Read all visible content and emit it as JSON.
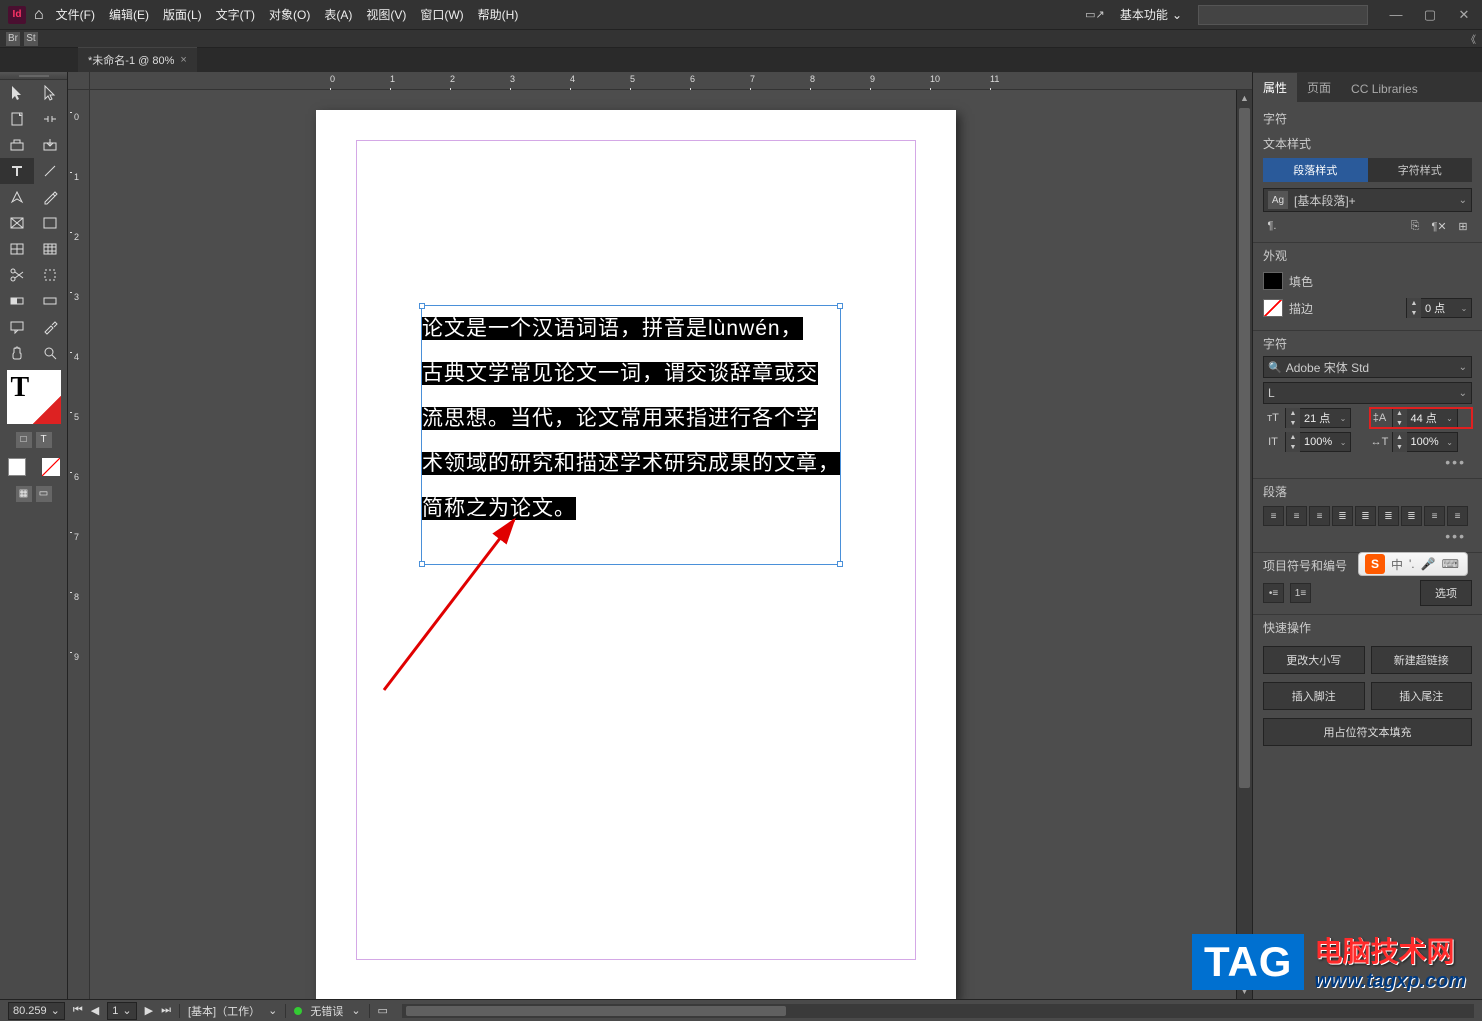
{
  "title_bar": {
    "app_abbrev": "Id",
    "menus": [
      "文件(F)",
      "编辑(E)",
      "版面(L)",
      "文字(T)",
      "对象(O)",
      "表(A)",
      "视图(V)",
      "窗口(W)",
      "帮助(H)"
    ],
    "workspace": "基本功能",
    "win_minimize": "—",
    "win_restore": "▢",
    "win_close": "✕"
  },
  "tab": {
    "label": "*未命名-1 @ 80%",
    "close": "×"
  },
  "ruler_h": [
    "0",
    "1",
    "2",
    "3",
    "4",
    "5",
    "6",
    "7",
    "8",
    "9",
    "10",
    "11"
  ],
  "ruler_v": [
    "0",
    "1",
    "2",
    "3",
    "4",
    "5",
    "6",
    "7",
    "8",
    "9"
  ],
  "document_text": {
    "l1": "论文是一个汉语词语，拼音是lùnwén，",
    "l2": "古典文学常见论文一词，谓交谈辞章或交",
    "l3": "流思想。当代，论文常用来指进行各个学",
    "l4": "术领域的研究和描述学术研究成果的文章，",
    "l5": "简称之为论文。"
  },
  "props": {
    "tabs": {
      "properties": "属性",
      "pages": "页面",
      "cclib": "CC Libraries"
    },
    "section_char_header": "字符",
    "text_style": {
      "header": "文本样式",
      "para_style_tab": "段落样式",
      "char_style_tab": "字符样式",
      "style_name": "[基本段落]+"
    },
    "appearance": {
      "header": "外观",
      "fill_label": "填色",
      "stroke_label": "描边",
      "stroke_val": "0 点"
    },
    "character": {
      "header": "字符",
      "font": "Adobe 宋体 Std",
      "font_style": "L",
      "size_val": "21 点",
      "leading_val": "44 点",
      "hscale_val": "100%",
      "vscale_val": "100%"
    },
    "paragraph": {
      "header": "段落"
    },
    "bullets": {
      "header": "项目符号和编号",
      "options_btn": "选项"
    },
    "quick": {
      "header": "快速操作",
      "change_case": "更改大小写",
      "new_hyperlink": "新建超链接",
      "insert_footnote": "插入脚注",
      "insert_endnote": "插入尾注",
      "fill_placeholder": "用占位符文本填充"
    }
  },
  "ime": {
    "label": "中"
  },
  "watermark": {
    "tag": "TAG",
    "cn": "电脑技术网",
    "url": "www.tagxp.com"
  },
  "status": {
    "zoom": "80.259",
    "page": "1",
    "state": "[基本]（工作）",
    "errors": "无错误"
  }
}
